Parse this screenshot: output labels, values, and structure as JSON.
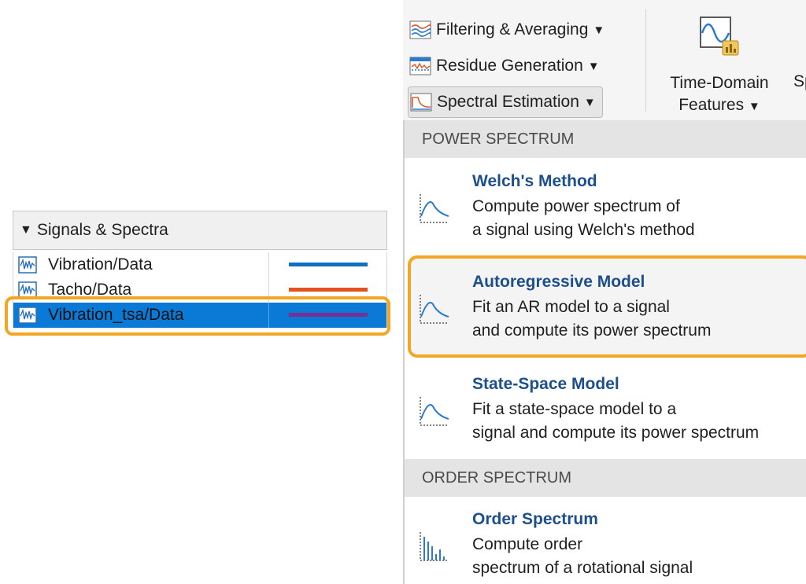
{
  "toolstrip": {
    "buttons": [
      {
        "label": "Filtering & Averaging",
        "icon": "filter-chart-icon"
      },
      {
        "label": "Residue Generation",
        "icon": "residue-chart-icon"
      },
      {
        "label": "Spectral Estimation",
        "icon": "spectral-chart-icon"
      }
    ],
    "time_domain": {
      "line1": "Time-Domain",
      "line2": "Features",
      "icon": "sine-wave-icon"
    },
    "cut_button_text": "Sp Fe"
  },
  "menu": {
    "sections": [
      {
        "header": "POWER SPECTRUM",
        "items": [
          {
            "title": "Welch's Method",
            "desc1": "Compute power spectrum of",
            "desc2": "a signal using Welch's method"
          },
          {
            "title": "Autoregressive Model",
            "desc1": "Fit an AR model to a signal",
            "desc2": "and compute its power spectrum"
          },
          {
            "title": "State-Space Model",
            "desc1": "Fit a state-space model to a",
            "desc2": "signal and compute its power spectrum"
          }
        ]
      },
      {
        "header": "ORDER SPECTRUM",
        "items": [
          {
            "title": "Order Spectrum",
            "desc1": "Compute order",
            "desc2": "spectrum of a rotational signal"
          }
        ]
      }
    ]
  },
  "panel": {
    "title": "Signals & Spectra",
    "signals": [
      {
        "name": "Vibration/Data",
        "color": "#0e6fc4",
        "selected": false
      },
      {
        "name": "Tacho/Data",
        "color": "#e0531d",
        "selected": false
      },
      {
        "name": "Vibration_tsa/Data",
        "color": "#7a2f93",
        "selected": true
      }
    ]
  },
  "colors": {
    "accent_highlight": "#f2a623",
    "selection": "#0a7ad6",
    "menu_title": "#1c4f8c"
  }
}
